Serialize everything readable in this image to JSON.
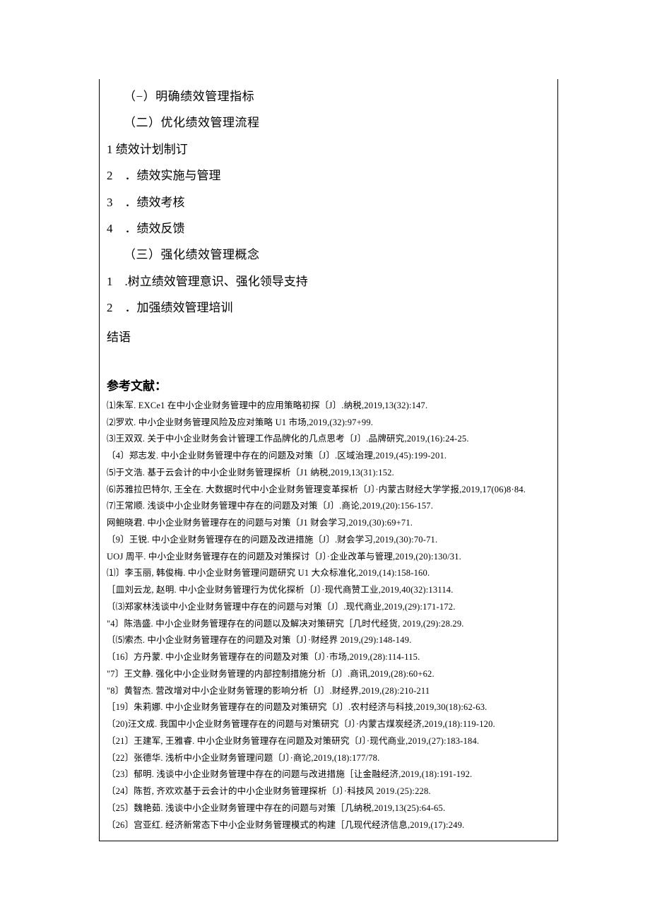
{
  "outline": {
    "s1": "（−）明确绩效管理指标",
    "s2": "（二）优化绩效管理流程",
    "s2_1": "1 绩效计划制订",
    "s2_2": "2　．绩效实施与管理",
    "s2_3": "3　．绩效考核",
    "s2_4": "4　．绩效反馈",
    "s3": "（三）强化绩效管理概念",
    "s3_1": "1　.树立绩效管理意识、强化领导支持",
    "s3_2": "2　．加强绩效管理培训",
    "conclusion": "结语"
  },
  "ref_heading": "参考文献：",
  "refs": {
    "r1": "⑴朱军. EXCe1 在中小企业财务管理中的应用策略初探〔J〕.纳税,2019,13(32):147.",
    "r2": "⑵罗欢. 中小企业财务管理风险及应对策略 U1 市场,2019,(32):97+99.",
    "r3": "⑶王双双. 关于中小企业财务会计管理工作品牌化的几点思考〔J〕.品牌研究,2019,(16):24-25.",
    "r4": "〔4〕郑志发. 中小企业财务管理中存在的问题及对策〔J〕.区域治理,2019,(45):199-201.",
    "r5": "⑸于文浩. 基于云会计的中小企业财务管理探析〔J1 纳税,2019,13(31):152.",
    "r6": "⑹苏雅拉巴特尔, 王全在. 大数据时代中小企业财务管理变革探析〔J〕·内蒙古财经大学学报,2019,17(06)8·84.",
    "r7": "⑺王常顺. 浅谈中小企业财务管理中存在的问题及对策〔J〕.商论,2019,(20):156-157.",
    "r8": "网鲍晓君. 中小企业财务管理存在的问题与对策〔J1 财会学习,2019,(30):69+71.",
    "r9": "〔9〕王锐. 中小企业财务管理存在的问题及改进措施〔J〕.财会学习,2019,(30):70-71.",
    "r10": "UOJ 周平. 中小企业财务管理存在的问题及对策探讨〔J〕·企业改革与管理,2019,(20):130/31.",
    "r11": "⑴〕李玉丽, 韩俊梅. 中小企业财务管理问题研究 U1 大众标准化,2019,(14):158-160.",
    "r12": "［皿刘云龙, 赵明. 中小企业财务管理行为优化探析〔J〕·现代商赞工业,2019,40(32):13114.",
    "r13": "〔⑶郑家林浅谈中小企业财务管理中存在的问题与对策〔J〕.现代商业,2019,(29):171-172.",
    "r14": "\"4〕陈浩盛. 中小企业财务管理存在的问题以及解决对策研究［几时代经货, 2019,(29):28.29.",
    "r15": "〔⑸索杰. 中小企业财务管理存在的问题及对策〔J〕·财经界 2019,(29):148-149.",
    "r16": "〔16〕方丹蒙. 中小企业财务管理存在的问题及对策〔J〕·市场,2019,(28):114-115.",
    "r17": "\"7〕王文静. 强化中小企业财务管理的内部控制措施分析〔J〕.商讯,2019,(28):60+62.",
    "r18": "\"8〕黄智杰. 营改增对中小企业财务管理的影响分析〔J〕.财经界,2019,(28):210-211",
    "r19": "［19〕朱莉娜. 中小企业财务管理存在的问题及对策研究〔J〕.农村经济与科技,2019,30(18):62-63.",
    "r20": "〔20)汪文成. 我国中小企业财务管理存在的问题与对策研究〔J〕·内蒙古煤炭经济,2019,(18):119-120.",
    "r21": "〔21〕王建军, 王雅睿. 中小企业财务管理存在问题及对策研究〔J〕·现代商业,2019,(27):183-184.",
    "r22": "〔22〕张德华. 浅析中小企业财务管理问题〔J〕·商论,2019,(18):177/78.",
    "r23": "〔23〕郁明. 浅谈中小企业财务管理中存在的问题与改进措施［让金融经济,2019,(18):191-192.",
    "r24": "〔24〕陈哲, 齐欢欢基于云会计的中小企业财务管理探析〔J〕·科技风 2019.(25):228.",
    "r25": "〔25〕魏艳茹. 浅谈中小企业财务管理中存在的问题与对策［几纳税,2019,13(25):64-65.",
    "r26": "〔26〕宫亚红. 经济新常态下中小企业财务管理模式的构建［几现代经济信息,2019,(17):249."
  }
}
